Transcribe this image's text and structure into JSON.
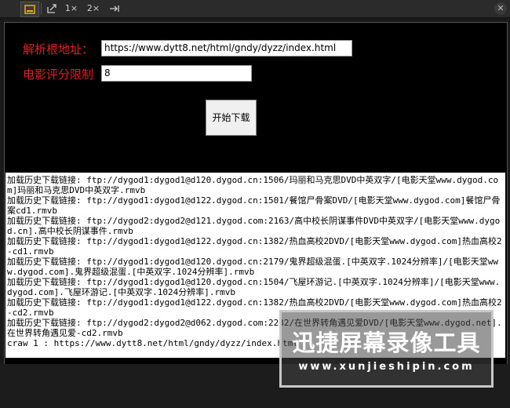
{
  "toolbar": {
    "zoom1": "1×",
    "zoom2": "2×"
  },
  "form": {
    "url_label": "解析根地址：",
    "url_value": "https://www.dytt8.net/html/gndy/dyzz/index.html",
    "score_label": "电影评分限制",
    "score_value": "8",
    "start_button": "开始下载"
  },
  "log": {
    "lines": [
      "加载历史下载链接: ftp://dygod1:dygod1@d120.dygod.cn:1506/玛丽和马克思DVD中英双字/[电影天堂www.dygod.com]玛丽和马克思DVD中英双字.rmvb",
      "加载历史下载链接: ftp://dygod1:dygod1@d122.dygod.cn:1501/餐馆尸骨案DVD/[电影天堂www.dygod.com]餐馆尸骨案cd1.rmvb",
      "加载历史下载链接: ftp://dygod2:dygod2@d121.dygod.com:2163/高中校长阴谋事件DVD中英双字/[电影天堂www.dygod.cn].高中校长阴谋事件.rmvb",
      "加载历史下载链接: ftp://dygod1:dygod1@d122.dygod.cn:1382/热血高校2DVD/[电影天堂www.dygod.com]热血高校2-cd1.rmvb",
      "加载历史下载链接: ftp://dygod1:dygod1@d120.dygod.cn:2179/鬼界超级混蛋.[中英双字.1024分辨率]/[电影天堂www.dygod.com].鬼界超级混蛋.[中英双字.1024分辨率].rmvb",
      "加载历史下载链接: ftp://dygod1:dygod1@d120.dygod.cn:1504/飞屋环游记.[中英双字.1024分辨率]/[电影天堂www.dygod.com].飞屋环游记.[中英双字.1024分辨率].rmvb",
      "加载历史下载链接: ftp://dygod1:dygod1@d122.dygod.cn:1382/热血高校2DVD/[电影天堂www.dygod.com]热血高校2-cd2.rmvb",
      "加载历史下载链接: ftp://dygod2:dygod2@d062.dygod.com:2232/在世界转角遇见爱DVD/[电影天堂www.dygod.net].在世界转角遇见爱-cd2.rmvb",
      "craw 1 : https://www.dytt8.net/html/gndy/dyzz/index.html"
    ]
  },
  "watermark": {
    "title": "迅捷屏幕录像工具",
    "url": "www.xunjieshipin.com"
  }
}
